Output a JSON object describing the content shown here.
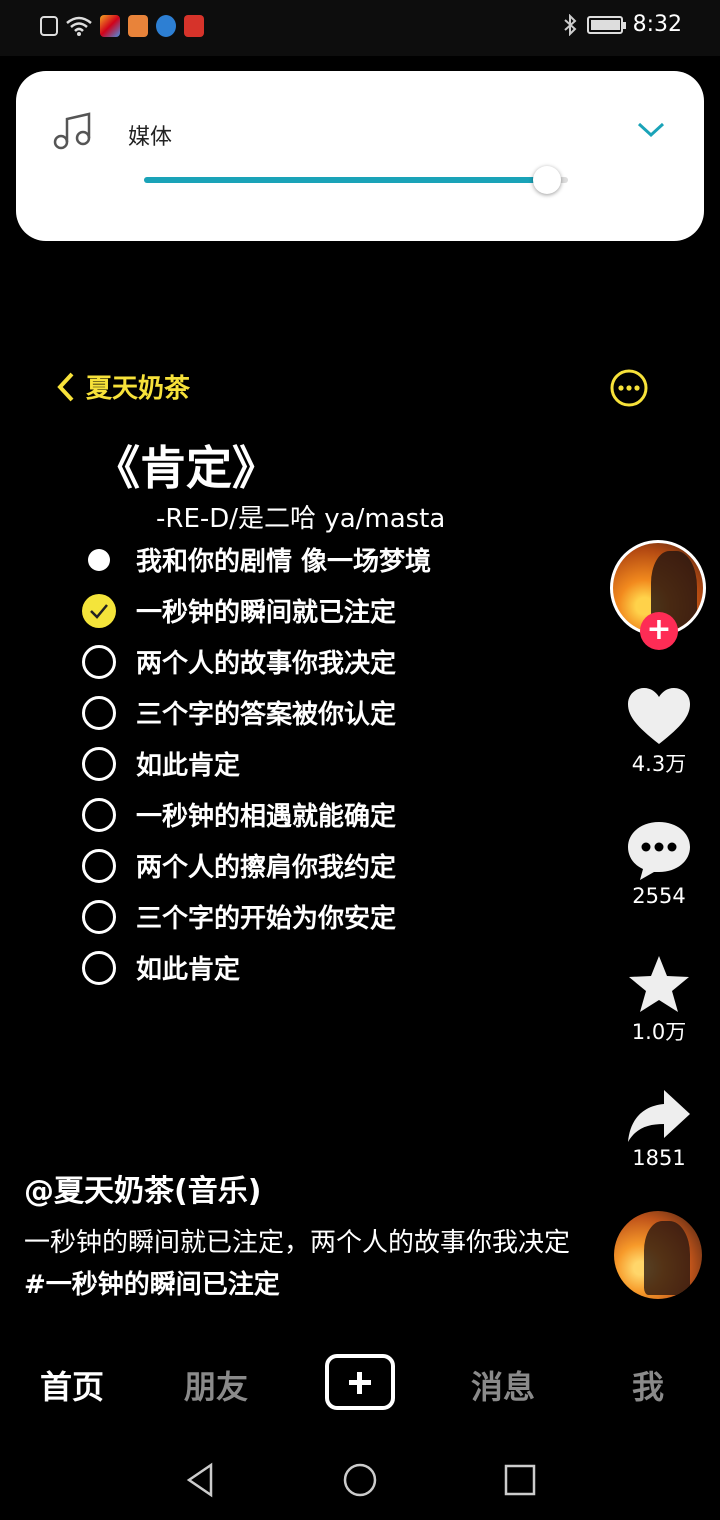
{
  "status_bar": {
    "time": "8:32",
    "icons": [
      "alert-icon",
      "wifi-icon",
      "app-icon-1",
      "app-icon-2",
      "app-icon-3",
      "app-icon-4",
      "bluetooth-icon",
      "battery-icon"
    ],
    "battery_level": 0.9
  },
  "volume_panel": {
    "label": "媒体",
    "level": 0.95,
    "accent_color": "#1aa3b8"
  },
  "video": {
    "back_label": "夏天奶茶",
    "title": "《肯定》",
    "artist": "-RE-D/是二哈 ya/masta",
    "lyrics": [
      {
        "text": "我和你的剧情 像一场梦境",
        "state": "filled"
      },
      {
        "text": "一秒钟的瞬间就已注定",
        "state": "checked"
      },
      {
        "text": "两个人的故事你我决定",
        "state": "empty"
      },
      {
        "text": "三个字的答案被你认定",
        "state": "empty"
      },
      {
        "text": "如此肯定",
        "state": "empty"
      },
      {
        "text": "一秒钟的相遇就能确定",
        "state": "empty"
      },
      {
        "text": "两个人的擦肩你我约定",
        "state": "empty"
      },
      {
        "text": "三个字的开始为你安定",
        "state": "empty"
      },
      {
        "text": "如此肯定",
        "state": "empty"
      }
    ],
    "highlight_color": "#f4e43a"
  },
  "rail": {
    "follow_label": "+",
    "likes": "4.3万",
    "comments": "2554",
    "favorites": "1.0万",
    "shares": "1851"
  },
  "post": {
    "author": "@夏天奶茶(音乐)",
    "caption": "一秒钟的瞬间就已注定，两个人的故事你我决定",
    "hashtag": "#一秒钟的瞬间已注定"
  },
  "tabs": {
    "home": "首页",
    "friends": "朋友",
    "messages": "消息",
    "me": "我"
  }
}
